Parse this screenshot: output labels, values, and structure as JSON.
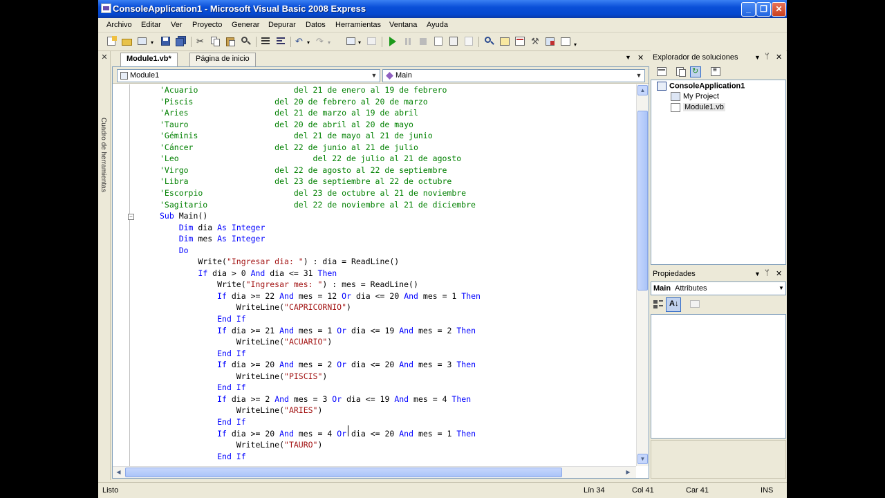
{
  "window": {
    "title": "ConsoleApplication1 - Microsoft Visual Basic 2008 Express"
  },
  "menu": [
    "Archivo",
    "Editar",
    "Ver",
    "Proyecto",
    "Generar",
    "Depurar",
    "Datos",
    "Herramientas",
    "Ventana",
    "Ayuda"
  ],
  "toolbox": {
    "label": "Cuadro de herramientas"
  },
  "tabs": [
    {
      "label": "Module1.vb*",
      "active": true
    },
    {
      "label": "Página de inicio",
      "active": false
    }
  ],
  "navigation": {
    "type_combo": "Module1",
    "member_combo": "Main"
  },
  "code_lines": [
    [
      [
        "cm",
        "'Acuario                    del 21 de enero al 19 de febrero"
      ]
    ],
    [
      [
        "cm",
        "'Piscis                 del 20 de febrero al 20 de marzo"
      ]
    ],
    [
      [
        "cm",
        "'Aries                  del 21 de marzo al 19 de abril"
      ]
    ],
    [
      [
        "cm",
        "'Tauro                  del 20 de abril al 20 de mayo"
      ]
    ],
    [
      [
        "cm",
        "'Géminis                    del 21 de mayo al 21 de junio"
      ]
    ],
    [
      [
        "cm",
        "'Cáncer                 del 22 de junio al 21 de julio"
      ]
    ],
    [
      [
        "cm",
        "'Leo                            del 22 de julio al 21 de agosto"
      ]
    ],
    [
      [
        "cm",
        "'Virgo                  del 22 de agosto al 22 de septiembre"
      ]
    ],
    [
      [
        "cm",
        "'Libra                  del 23 de septiembre al 22 de octubre"
      ]
    ],
    [
      [
        "cm",
        "'Escorpio                   del 23 de octubre al 21 de noviembre"
      ]
    ],
    [
      [
        "cm",
        "'Sagitario                  del 22 de noviembre al 21 de diciembre"
      ]
    ],
    [
      [
        "kw",
        "Sub"
      ],
      [
        "",
        " Main()"
      ]
    ],
    [
      [
        "",
        "    "
      ],
      [
        "kw",
        "Dim"
      ],
      [
        "",
        " dia "
      ],
      [
        "kw",
        "As"
      ],
      [
        "",
        " "
      ],
      [
        "kw",
        "Integer"
      ]
    ],
    [
      [
        "",
        "    "
      ],
      [
        "kw",
        "Dim"
      ],
      [
        "",
        " mes "
      ],
      [
        "kw",
        "As"
      ],
      [
        "",
        " "
      ],
      [
        "kw",
        "Integer"
      ]
    ],
    [
      [
        "",
        "    "
      ],
      [
        "kw",
        "Do"
      ]
    ],
    [
      [
        "",
        "        Write("
      ],
      [
        "str",
        "\"Ingresar dia: \""
      ],
      [
        "",
        ") : dia = ReadLine()"
      ]
    ],
    [
      [
        "",
        "        "
      ],
      [
        "kw",
        "If"
      ],
      [
        "",
        " dia > 0 "
      ],
      [
        "kw",
        "And"
      ],
      [
        "",
        " dia <= 31 "
      ],
      [
        "kw",
        "Then"
      ]
    ],
    [
      [
        "",
        "            Write("
      ],
      [
        "str",
        "\"Ingresar mes: \""
      ],
      [
        "",
        ") : mes = ReadLine()"
      ]
    ],
    [
      [
        "",
        "            "
      ],
      [
        "kw",
        "If"
      ],
      [
        "",
        " dia >= 22 "
      ],
      [
        "kw",
        "And"
      ],
      [
        "",
        " mes = 12 "
      ],
      [
        "kw",
        "Or"
      ],
      [
        "",
        " dia <= 20 "
      ],
      [
        "kw",
        "And"
      ],
      [
        "",
        " mes = 1 "
      ],
      [
        "kw",
        "Then"
      ]
    ],
    [
      [
        "",
        "                WriteLine("
      ],
      [
        "str",
        "\"CAPRICORNIO\""
      ],
      [
        "",
        ")"
      ]
    ],
    [
      [
        "",
        "            "
      ],
      [
        "kw",
        "End If"
      ]
    ],
    [
      [
        "",
        "            "
      ],
      [
        "kw",
        "If"
      ],
      [
        "",
        " dia >= 21 "
      ],
      [
        "kw",
        "And"
      ],
      [
        "",
        " mes = 1 "
      ],
      [
        "kw",
        "Or"
      ],
      [
        "",
        " dia <= 19 "
      ],
      [
        "kw",
        "And"
      ],
      [
        "",
        " mes = 2 "
      ],
      [
        "kw",
        "Then"
      ]
    ],
    [
      [
        "",
        "                WriteLine("
      ],
      [
        "str",
        "\"ACUARIO\""
      ],
      [
        "",
        ")"
      ]
    ],
    [
      [
        "",
        "            "
      ],
      [
        "kw",
        "End If"
      ]
    ],
    [
      [
        "",
        "            "
      ],
      [
        "kw",
        "If"
      ],
      [
        "",
        " dia >= 20 "
      ],
      [
        "kw",
        "And"
      ],
      [
        "",
        " mes = 2 "
      ],
      [
        "kw",
        "Or"
      ],
      [
        "",
        " dia <= 20 "
      ],
      [
        "kw",
        "And"
      ],
      [
        "",
        " mes = 3 "
      ],
      [
        "kw",
        "Then"
      ]
    ],
    [
      [
        "",
        "                WriteLine("
      ],
      [
        "str",
        "\"PISCIS\""
      ],
      [
        "",
        ")"
      ]
    ],
    [
      [
        "",
        "            "
      ],
      [
        "kw",
        "End If"
      ]
    ],
    [
      [
        "",
        "            "
      ],
      [
        "kw",
        "If"
      ],
      [
        "",
        " dia >= 2 "
      ],
      [
        "kw",
        "And"
      ],
      [
        "",
        " mes = 3 "
      ],
      [
        "kw",
        "Or"
      ],
      [
        "",
        " dia <= 19 "
      ],
      [
        "kw",
        "And"
      ],
      [
        "",
        " mes = 4 "
      ],
      [
        "kw",
        "Then"
      ]
    ],
    [
      [
        "",
        "                WriteLine("
      ],
      [
        "str",
        "\"ARIES\""
      ],
      [
        "",
        ")"
      ]
    ],
    [
      [
        "",
        "            "
      ],
      [
        "kw",
        "End If"
      ]
    ],
    [
      [
        "",
        "            "
      ],
      [
        "kw",
        "If"
      ],
      [
        "",
        " dia >= 20 "
      ],
      [
        "kw",
        "And"
      ],
      [
        "",
        " mes = 4 "
      ],
      [
        "kw",
        "Or"
      ],
      [
        "",
        " dia <= 20 "
      ],
      [
        "kw",
        "And"
      ],
      [
        "",
        " mes = 1 "
      ],
      [
        "kw",
        "Then"
      ]
    ],
    [
      [
        "",
        "                WriteLine("
      ],
      [
        "str",
        "\"TAURO\""
      ],
      [
        "",
        ")"
      ]
    ],
    [
      [
        "",
        "            "
      ],
      [
        "kw",
        "End If"
      ]
    ]
  ],
  "colors": {
    "keyword": "#0000ff",
    "string": "#a31515",
    "comment": "#008000",
    "titlebar": "#0548cf"
  },
  "solution_explorer": {
    "title": "Explorador de soluciones",
    "items": [
      {
        "label": "ConsoleApplication1",
        "bold": true
      },
      {
        "label": "My Project"
      },
      {
        "label": "Module1.vb"
      }
    ]
  },
  "properties": {
    "title": "Propiedades",
    "object_name": "Main",
    "object_type": "Attributes"
  },
  "status": {
    "text": "Listo",
    "line": "Lín 34",
    "col": "Col 41",
    "car": "Car 41",
    "mode": "INS"
  }
}
